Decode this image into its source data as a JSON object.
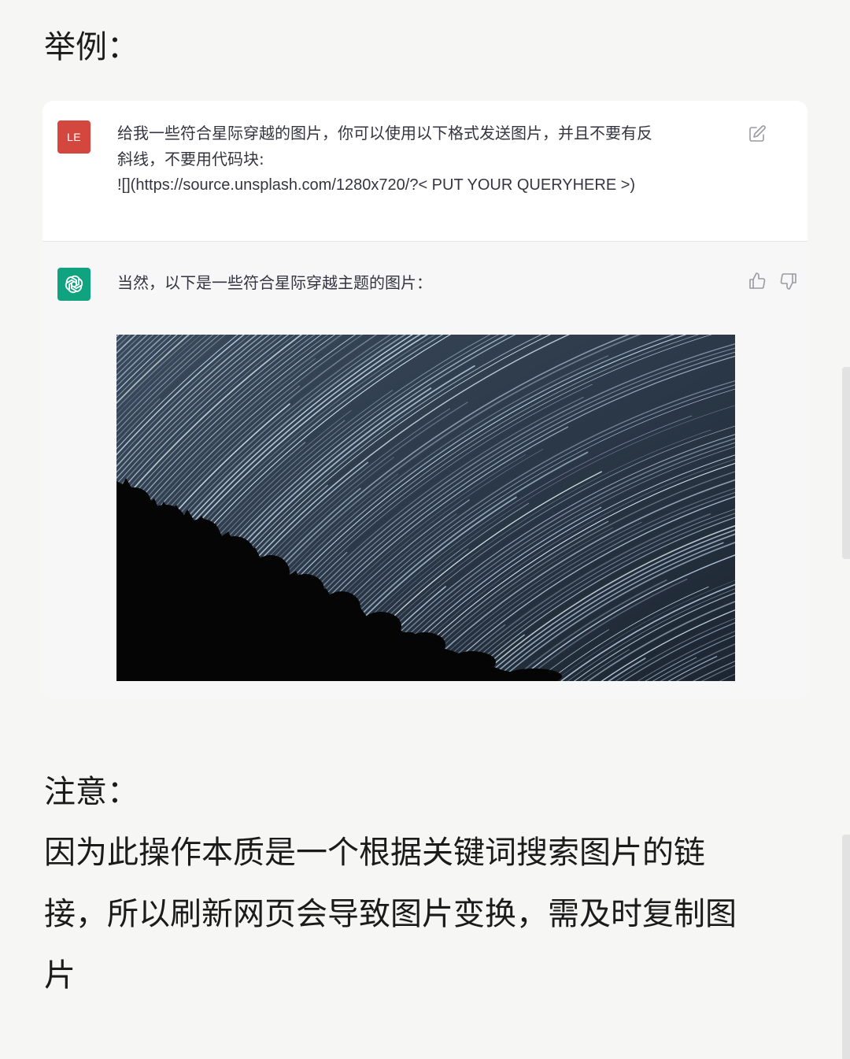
{
  "heading_example": "举例：",
  "chat": {
    "user": {
      "avatar_initials": "LE",
      "message_lines": [
        "给我一些符合星际穿越的图片，你可以使用以下格式发送图片，并且不要有反",
        "斜线，不要用代码块:",
        "![](https://source.unsplash.com/1280x720/?< PUT YOUR QUERYHERE >)"
      ],
      "edit_icon": "edit-icon"
    },
    "assistant": {
      "avatar_icon": "openai-logo-icon",
      "message": "当然，以下是一些符合星际穿越主题的图片：",
      "actions": [
        "thumbs-up-icon",
        "thumbs-down-icon"
      ],
      "image": "star-trails-over-tree-silhouettes"
    }
  },
  "heading_note": "注意：",
  "note_lines": [
    "因为此操作本质是一个根据关键词搜索图片的链",
    "接，所以刷新网页会导致图片变换，需及时复制图",
    "片"
  ],
  "colors": {
    "page_bg": "#f6f6f5",
    "user_avatar": "#d4473f",
    "assistant_avatar": "#10a37f",
    "assistant_bg": "#f7f7f8"
  }
}
